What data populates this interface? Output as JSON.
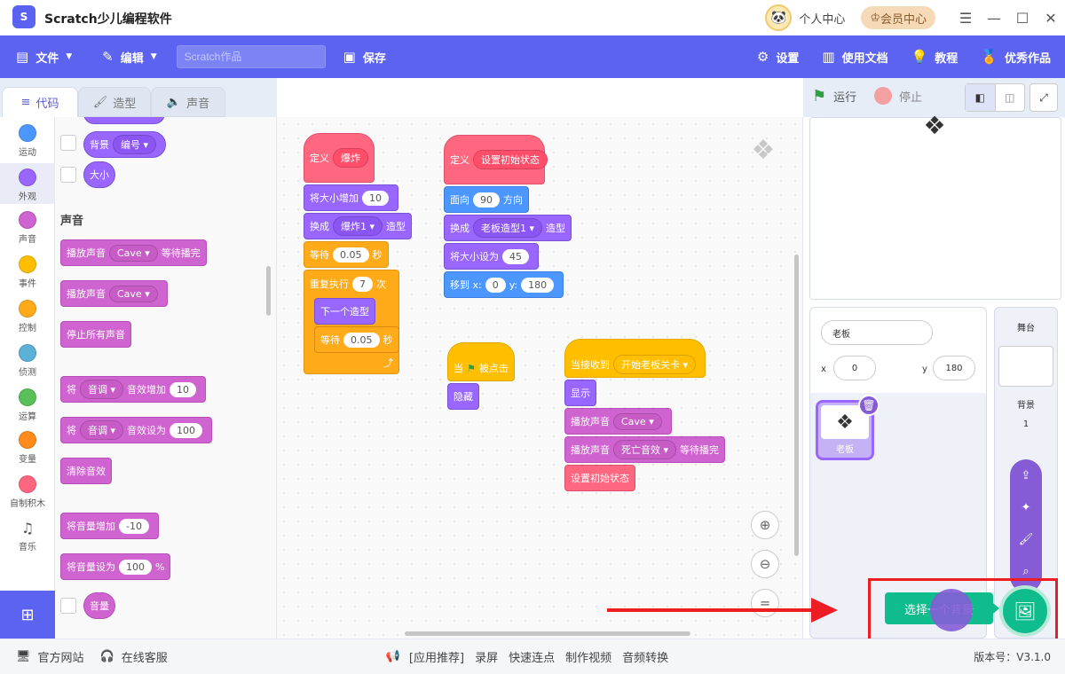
{
  "app": {
    "title": "Scratch少儿编程软件",
    "logo": "S"
  },
  "titlebar": {
    "user_center": "个人中心",
    "vip": "会员中心"
  },
  "menubar": {
    "file": "文件",
    "edit": "编辑",
    "project_placeholder": "Scratch作品",
    "save": "保存",
    "settings": "设置",
    "docs": "使用文档",
    "tutorial": "教程",
    "works": "优秀作品"
  },
  "tabs": {
    "code": "代码",
    "costume": "造型",
    "sound": "声音"
  },
  "categories": [
    {
      "label": "运动",
      "color": "#4c97ff"
    },
    {
      "label": "外观",
      "color": "#9966ff"
    },
    {
      "label": "声音",
      "color": "#cf63cf"
    },
    {
      "label": "事件",
      "color": "#ffbf00"
    },
    {
      "label": "控制",
      "color": "#ffab19"
    },
    {
      "label": "侦测",
      "color": "#5cb1d6"
    },
    {
      "label": "运算",
      "color": "#59c059"
    },
    {
      "label": "变量",
      "color": "#ff8c1a"
    },
    {
      "label": "自制积木",
      "color": "#ff6680"
    },
    {
      "label": "音乐",
      "color": "#ffffff"
    }
  ],
  "palette": {
    "backdrop": "背景",
    "backdrop_opt": "编号",
    "size": "大小",
    "section_sound": "声音",
    "play_until_done": "播放声音",
    "sound_name": "Cave",
    "until_done": "等待播完",
    "play": "播放声音",
    "stop_all": "停止所有声音",
    "change_effect": "将",
    "effect": "音调",
    "effect_by": "音效增加",
    "effect_val": "10",
    "set_effect": "将",
    "set_effect_to": "音效设为",
    "set_val": "100",
    "clear_effects": "清除音效",
    "change_vol": "将音量增加",
    "vol_change": "-10",
    "set_vol": "将音量设为",
    "vol_val": "100",
    "percent": "%",
    "volume": "音量"
  },
  "scripts": {
    "s1": {
      "define": "定义",
      "name": "爆炸",
      "size_by": "将大小增加",
      "size_val": "10",
      "switch": "换成",
      "costume": "爆炸1",
      "costume_suffix": "造型",
      "wait": "等待",
      "wait_val": "0.05",
      "sec": "秒",
      "repeat": "重复执行",
      "repeat_val": "7",
      "times": "次",
      "next": "下一个造型"
    },
    "s2": {
      "define": "定义",
      "name": "设置初始状态",
      "point": "面向",
      "dir": "90",
      "dir_suffix": "方向",
      "switch": "换成",
      "costume": "老板造型1",
      "costume_suffix": "造型",
      "set_size": "将大小设为",
      "size": "45",
      "goto": "移到 x:",
      "x": "0",
      "y_label": "y:",
      "y": "180"
    },
    "s3": {
      "when": "当",
      "clicked": "被点击",
      "hide": "隐藏"
    },
    "s4": {
      "receive": "当接收到",
      "msg": "开始老板关卡",
      "show": "显示",
      "play": "播放声音",
      "sound": "Cave",
      "play2": "播放声音",
      "sound2": "死亡音效",
      "until": "等待播完",
      "init": "设置初始状态"
    }
  },
  "stage": {
    "run": "运行",
    "stop": "停止"
  },
  "sprite": {
    "name": "老板",
    "x_label": "x",
    "x": "0",
    "y_label": "y",
    "y": "180",
    "thumb_label": "老板"
  },
  "stage_panel": {
    "title": "舞台",
    "backdrops": "背景",
    "count": "1"
  },
  "tooltip": "选择一个背景",
  "statusbar": {
    "site": "官方网站",
    "service": "在线客服",
    "recommend": "[应用推荐]",
    "rec1": "录屏",
    "rec2": "快速连点",
    "rec3": "制作视频",
    "rec4": "音频转换",
    "version": "版本号：V3.1.0"
  }
}
